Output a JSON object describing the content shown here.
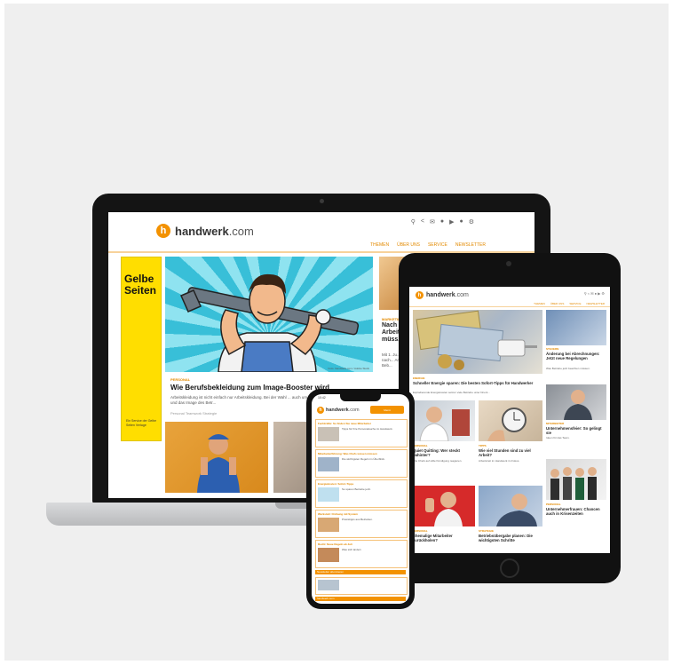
{
  "brand": {
    "name_bold": "handwerk",
    "name_suffix": ".com",
    "accent": "#f39200",
    "ad_yellow": "#ffde00"
  },
  "laptop": {
    "icons": [
      "search-icon",
      "share-icon",
      "mail-icon",
      "facebook-icon",
      "youtube-icon",
      "instagram-icon",
      "settings-icon"
    ],
    "nav": [
      "THEMEN",
      "ÜBER UNS",
      "SERVICE",
      "NEWSLETTER"
    ],
    "ad": {
      "title_line1": "Gelbe",
      "title_line2": "Seiten",
      "small": "Ein Service der Gelbe Seiten Verlage"
    },
    "hero": {
      "credit": "Foto: handwerk.com / Adobe Stock"
    },
    "article": {
      "kicker": "PERSONAL",
      "title": "Wie Berufsbekleidung zum Image-Booster wird",
      "text": "Arbeitskleidung ist nicht einfach nur Arbeitskleidung. Bei der Wahl ... auch um Wertschätzung für die Mitarbeiter und das Image des Betr...",
      "tags": "Personal   Teamwork   Strategie"
    },
    "side": {
      "kicker": "MARKETING",
      "title": "Nach Arbeit... müss...",
      "text": "Mit 1. Ju... auf nach... Arbeit... für Beb..."
    }
  },
  "tablet": {
    "nav": [
      "THEMEN",
      "ÜBER UNS",
      "SERVICE",
      "NEWSLETTER"
    ],
    "articles": [
      {
        "kicker": "ENERGIE",
        "title": "Schneller Energie sparen: Die besten Sofort-Tipps für Handwerker",
        "text": "Explodierende Energiekosten setzen viele Betriebe unter Druck..."
      },
      {
        "kicker": "STEUERN",
        "title": "Änderung bei Abrechnungen: Jetzt neue Regelungen",
        "text": "Was Betriebe jetzt beachten müssen."
      },
      {
        "kicker": "PERSONAL",
        "title": "Quiet Quitting: Wer steckt dahinter?",
        "text": "Wie Chefs auf stille Kündigung reagieren."
      },
      {
        "kicker": "TIPPS",
        "title": "Wie viel Stunden sind zu viel Arbeit?",
        "text": "Arbeitszeit im Handwerk im Fokus."
      },
      {
        "kicker": "MITARBEITER",
        "title": "Unternehmensfeier: So gelingt sie",
        "text": "Ideen für das Team."
      },
      {
        "kicker": "PERSONAL",
        "title": "Ehemalige Mitarbeiter zurückholen?",
        "text": "Chancen und Risiken."
      },
      {
        "kicker": "STRATEGIE",
        "title": "Betriebsübergabe planen: Die wichtigsten Schritte",
        "text": "Frühzeitig vorbereiten."
      },
      {
        "kicker": "PERSONAL",
        "title": "Unternehmerfrauen: Chancen auch in Krisenzeiten",
        "text": "Netzwerke im Handwerk."
      }
    ]
  },
  "phone": {
    "status_time": "10:42",
    "menu_label": "Menü",
    "rows": [
      {
        "kicker": "Fachkräfte: So finden Sie neue Mitarbeiter",
        "text": "Tipps für Ihre Personalsuche im Handwerk."
      },
      {
        "kicker": "Mitarbeiterführung: Was Chefs wissen müssen",
        "text": "Die wichtigsten Regeln im Überblick."
      },
      {
        "kicker": "Energiekosten: Sofort-Tipps",
        "text": "So sparen Betriebe jetzt."
      },
      {
        "kicker": "Werkstatt: Ordnung mit System",
        "text": "Praxistipps aus Betrieben."
      },
      {
        "kicker": "Recht: Neue Regeln ab Juli",
        "text": "Was sich ändert."
      }
    ],
    "bars": [
      "Newsletter abonnieren",
      "handwerk.com"
    ]
  }
}
